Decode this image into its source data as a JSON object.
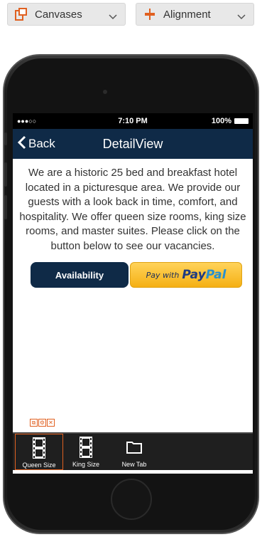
{
  "toolbar": {
    "canvases_label": "Canvases",
    "alignment_label": "Alignment"
  },
  "status": {
    "signal": "●●●○○",
    "time": "7:10 PM",
    "battery": "100%"
  },
  "nav": {
    "back_label": "Back",
    "title": "DetailView"
  },
  "content": {
    "body": "We are a historic 25 bed and breakfast hotel located in a picturesque area. We provide our guests with a look back in time, comfort, and hospitality. We offer queen size rooms, king size rooms, and master suites. Please click on the button below to see our vacancies.",
    "availability_label": "Availability",
    "paypal_pay_with": "Pay with",
    "paypal_pay": "Pay",
    "paypal_pal": "Pal"
  },
  "tabs": [
    {
      "label": "Queen Size",
      "icon": "film-icon"
    },
    {
      "label": "King Size",
      "icon": "film-icon"
    },
    {
      "label": "New Tab",
      "icon": "folder-icon"
    }
  ],
  "colors": {
    "accent": "#0f2a47",
    "selection": "#e06020",
    "paypal_yellow": "#f5b014"
  }
}
